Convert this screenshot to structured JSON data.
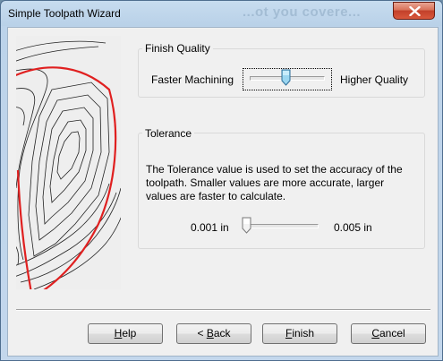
{
  "window": {
    "title": "Simple Toolpath Wizard",
    "background_text": "...ot you covere..."
  },
  "finish_quality": {
    "group_label": "Finish Quality",
    "left_label": "Faster Machining",
    "right_label": "Higher Quality",
    "slider_value_fraction": 0.5
  },
  "tolerance": {
    "group_label": "Tolerance",
    "description": "The Tolerance value is used to set the accuracy of the toolpath.  Smaller values are more accurate, larger values are faster to calculate.",
    "min_label": "0.001 in",
    "max_label": "0.005 in",
    "slider_value_fraction": 0.0
  },
  "buttons": {
    "help": {
      "label": "Help",
      "mnemonic": "H",
      "rest": "elp",
      "prefix": ""
    },
    "back": {
      "label": "< Back",
      "prefix": "< ",
      "mnemonic": "B",
      "rest": "ack"
    },
    "finish": {
      "label": "Finish",
      "prefix": "",
      "mnemonic": "F",
      "rest": "inish"
    },
    "cancel": {
      "label": "Cancel",
      "prefix": "",
      "mnemonic": "C",
      "rest": "ancel"
    }
  },
  "icons": {
    "close": "close-x-icon",
    "preview": "toolpath-offset-preview"
  },
  "colors": {
    "toolpath_outline": "#e02020",
    "toolpath_lines": "#222222",
    "close_button": "#c9462d",
    "slider_thumb_active": "#8fd0ee"
  }
}
